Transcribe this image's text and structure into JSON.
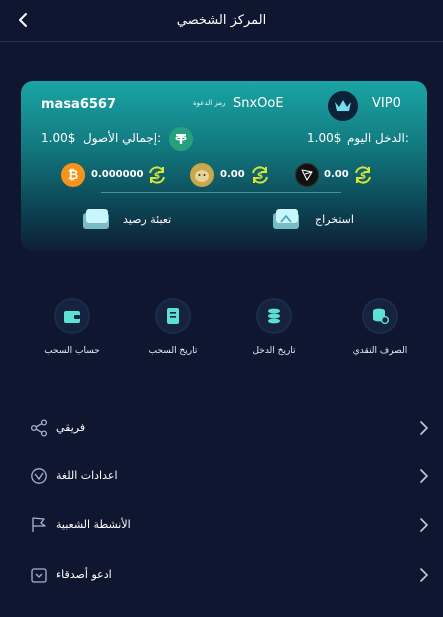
{
  "header": {
    "title": "المركز الشخصي"
  },
  "card": {
    "username": "masa6567",
    "invite_label": "رمز الدعوة",
    "invite_code": "SnxOoE",
    "vip": "VIP0",
    "total_assets_label": "إجمالي الأصول:",
    "total_assets_value": "1.00$",
    "today_income_label": "الدخل اليوم:",
    "today_income_value": "1.00$",
    "coins": [
      {
        "name": "bitcoin",
        "value": "0.000000"
      },
      {
        "name": "dogecoin",
        "value": "0.00"
      },
      {
        "name": "tron",
        "value": "0.00"
      }
    ],
    "deposit_label": "تعبئة رصيد",
    "withdraw_label": "استخراج"
  },
  "quick_actions": [
    {
      "label": "حساب السحب"
    },
    {
      "label": "تاريخ السحب"
    },
    {
      "label": "تاريخ الدخل"
    },
    {
      "label": "الصرف النقدي"
    }
  ],
  "menu": [
    {
      "label": "فريقي"
    },
    {
      "label": "اعدادات اللغة"
    },
    {
      "label": "الأنشطة الشعبية"
    },
    {
      "label": "ادعو أصدقاء"
    }
  ],
  "colors": {
    "background": "#0f1730",
    "card_top": "#1aa5a4",
    "tether": "#26a17b",
    "bitcoin": "#f7931a",
    "swap": "#d7e53a"
  }
}
